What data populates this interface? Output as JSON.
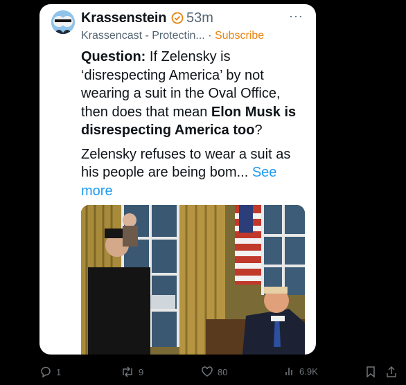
{
  "post": {
    "author": "Krassenstein",
    "time": "53m",
    "more": "···",
    "community": "Krassencast - Protectin...",
    "separator": "·",
    "subscribe": "Subscribe",
    "question_label": "Question:",
    "question_part1": " If Zelensky is ‘disrespecting America’ by not wearing a suit in the Oval Office, then does that mean ",
    "question_bold": "Elon Musk is disrespecting America too",
    "question_end": "?",
    "body": "Zelensky refuses to wear a suit as his people are being bom...",
    "see_more": " See more"
  },
  "actions": {
    "replies": "1",
    "reposts": "9",
    "likes": "80",
    "views": "6.9K"
  },
  "colors": {
    "accent": "#1d9bf0",
    "subscribe": "#e8830f",
    "verified": "#e8830f"
  },
  "icons": [
    "reply-icon",
    "repost-icon",
    "like-icon",
    "views-icon",
    "bookmark-icon",
    "share-icon",
    "verified-icon",
    "more-icon"
  ]
}
